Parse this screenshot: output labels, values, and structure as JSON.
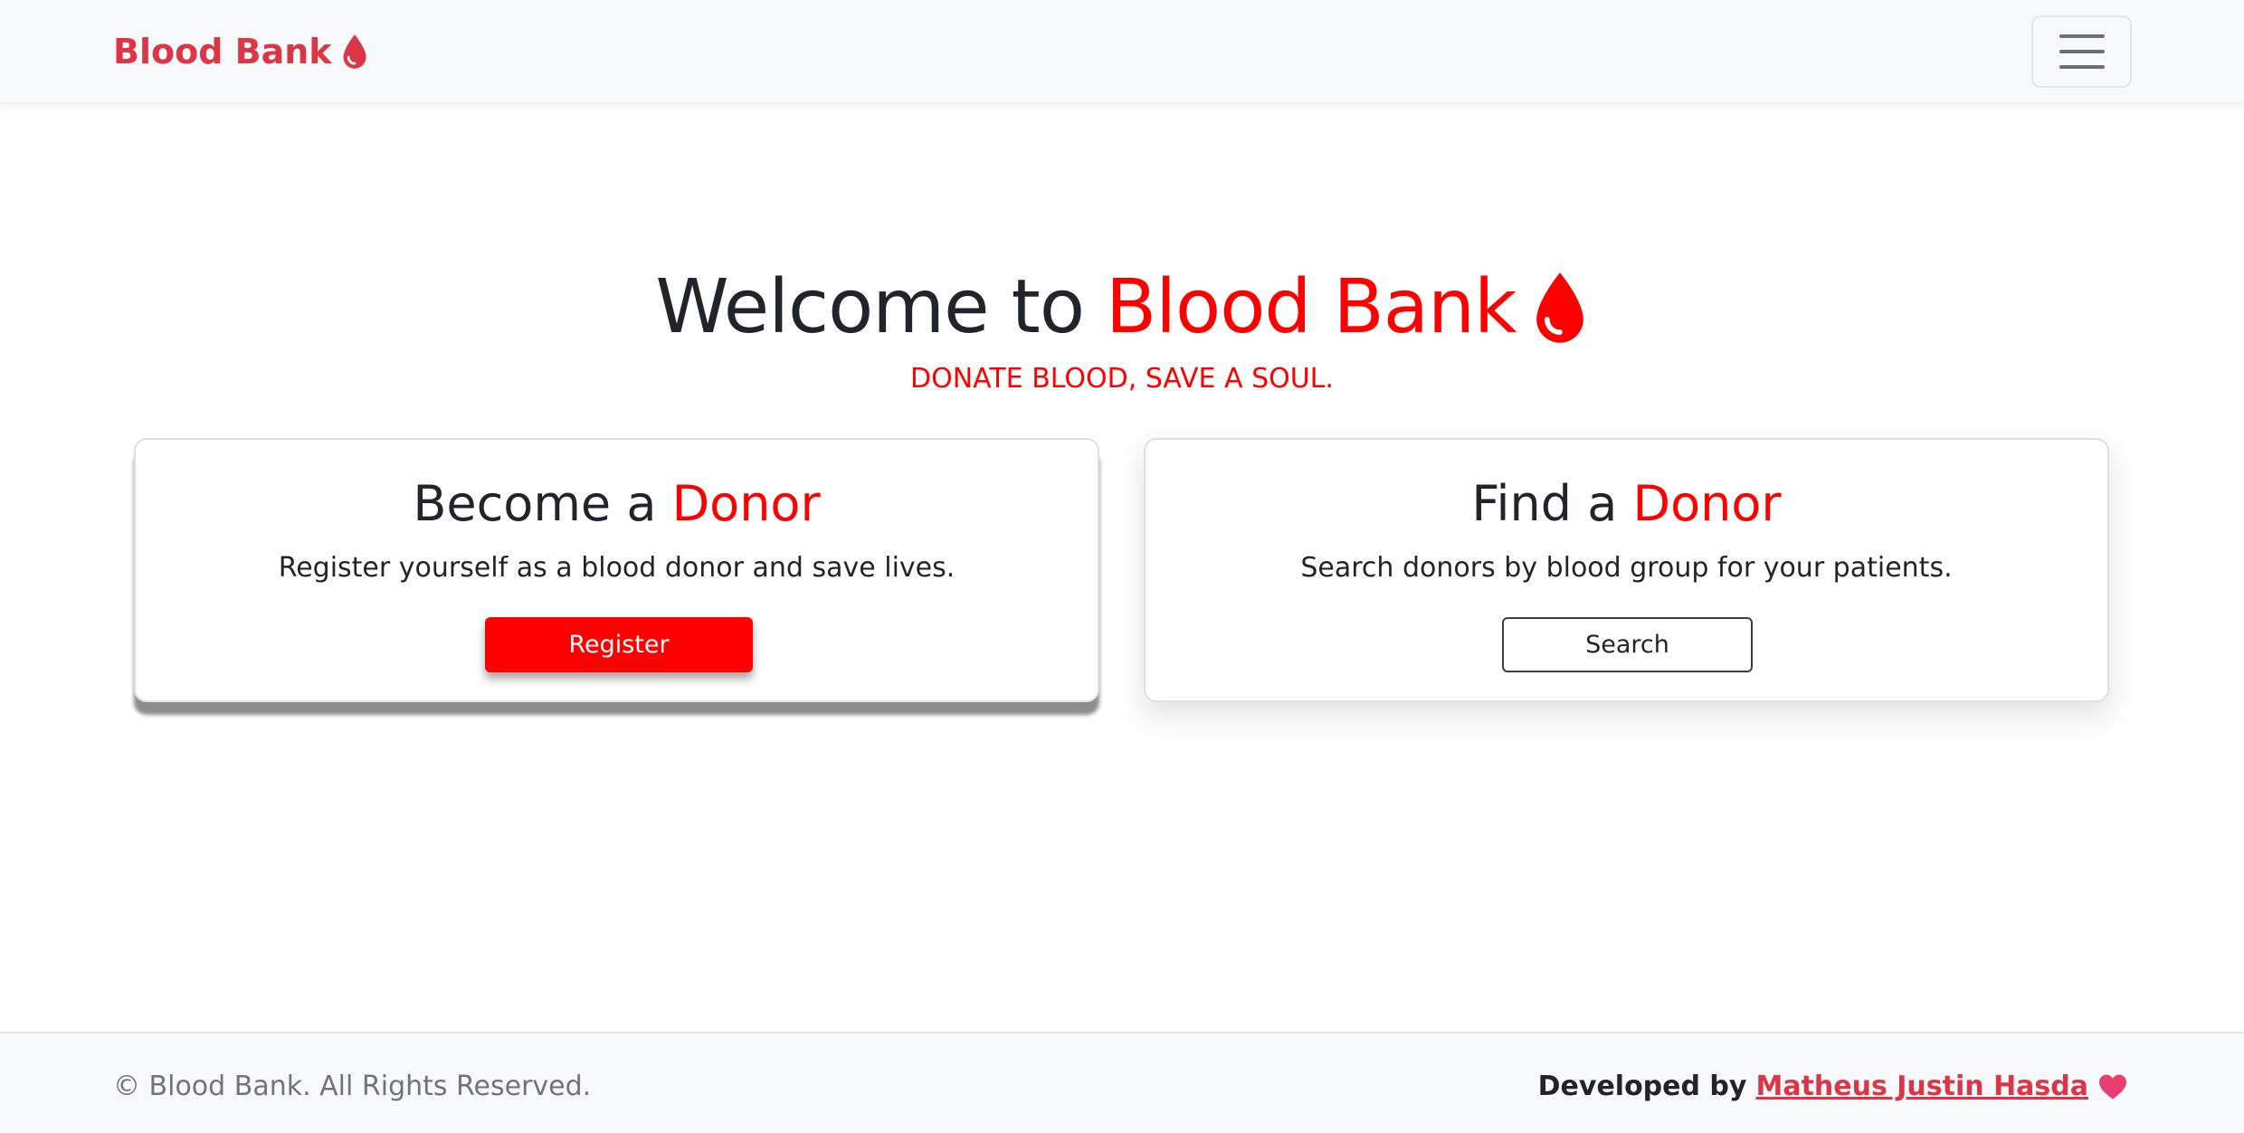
{
  "navbar": {
    "brand": "Blood Bank",
    "brand_icon": "blood-drop-icon",
    "toggler_icon": "hamburger-menu-icon"
  },
  "hero": {
    "title_prefix": "Welcome to",
    "title_highlight": "Blood Bank",
    "title_icon": "blood-drop-icon",
    "tagline": "DONATE BLOOD, SAVE A SOUL."
  },
  "cards": {
    "become": {
      "title_prefix": "Become a",
      "title_highlight": "Donor",
      "text": "Register yourself as a blood donor and save lives.",
      "button": "Register"
    },
    "find": {
      "title_prefix": "Find a",
      "title_highlight": "Donor",
      "text": "Search donors by blood group for your patients.",
      "button": "Search"
    }
  },
  "footer": {
    "copyright": "© Blood Bank. All Rights Reserved.",
    "credit_prefix": "Developed by",
    "credit_name": "Matheus Justin Hasda",
    "credit_icon": "heart-icon"
  },
  "colors": {
    "accent": "#ff0000",
    "brand": "#dc3545",
    "heart": "#e83e72"
  }
}
